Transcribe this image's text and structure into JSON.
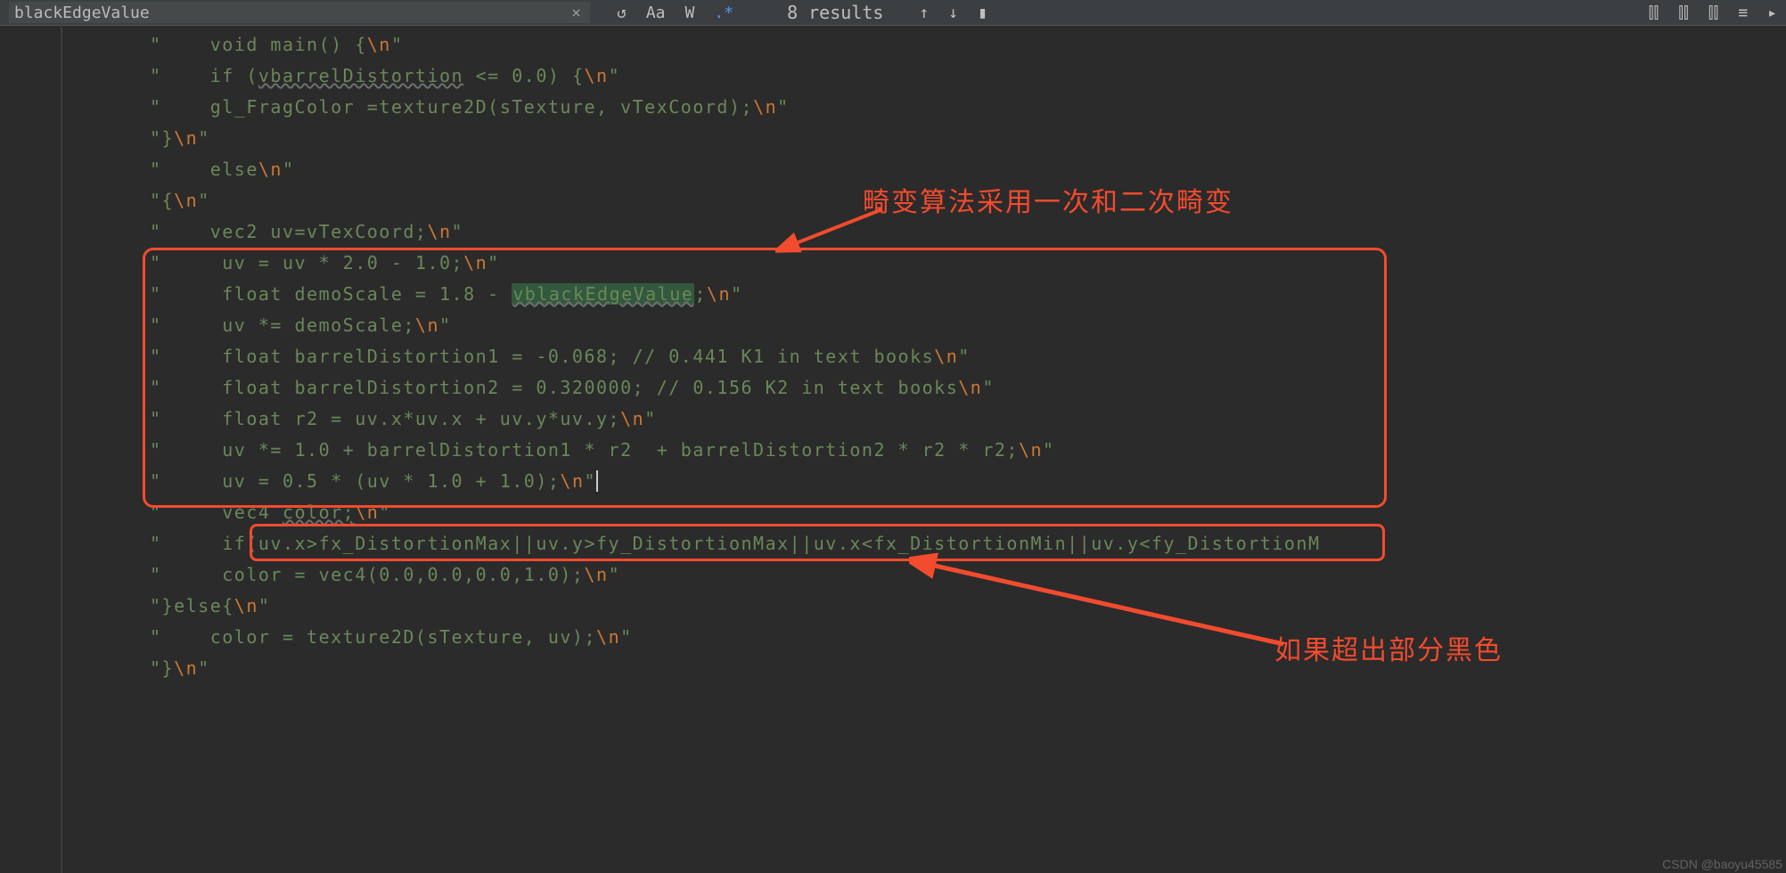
{
  "search": {
    "query": "blackEdgeValue",
    "results": "8 results"
  },
  "toolbar": {
    "close": "×",
    "prev": "↑",
    "next": "↓",
    "aa": "Aa",
    "ww": "W",
    "regex": ".*",
    "arrow_up": "↑",
    "arrow_down": "↓",
    "select_all": "▮",
    "filter1": "⫿⫿",
    "filter2": "⫿⫿",
    "filter3": "⫿⫿",
    "more": "≡",
    "pin": "▸"
  },
  "code": {
    "l01_a": "\"    void main() {",
    "l01_b": "\\n",
    "l01_c": "\"",
    "l02_a": "\"    if (",
    "l02_warn": "vbarrelDistortion",
    "l02_b": " <= 0.0) {",
    "l02_nl": "\\n",
    "l02_c": "\"",
    "l03_a": "\"    gl_FragColor =texture2D(sTexture, vTexCoord);",
    "l03_nl": "\\n",
    "l03_c": "\"",
    "l04_a": "\"}",
    "l04_nl": "\\n",
    "l04_c": "\"",
    "l05_a": "\"    else",
    "l05_nl": "\\n",
    "l05_c": "\"",
    "l06_a": "\"{",
    "l06_nl": "\\n",
    "l06_c": "\"",
    "l07_a": "\"    vec2 uv=vTexCoord;",
    "l07_nl": "\\n",
    "l07_c": "\"",
    "l08_a": "\"     uv = uv * 2.0 - 1.0;",
    "l08_nl": "\\n",
    "l08_c": "\"",
    "l09_a": "\"     float demoScale = 1.8 - ",
    "l09_hl": "vblackEdgeValue",
    "l09_b": ";",
    "l09_nl": "\\n",
    "l09_c": "\"",
    "l10_a": "\"     uv *= demoScale;",
    "l10_nl": "\\n",
    "l10_c": "\"",
    "l11_a": "\"     float barrelDistortion1 = -0.068; // 0.441 K1 in text books",
    "l11_nl": "\\n",
    "l11_c": "\"",
    "l12_a": "\"     float barrelDistortion2 = 0.320000; // 0.156 K2 in text books",
    "l12_nl": "\\n",
    "l12_c": "\"",
    "l13_a": "\"     float r2 = uv.x*uv.x + uv.y*uv.y;",
    "l13_nl": "\\n",
    "l13_c": "\"",
    "l14_a": "\"     uv *= 1.0 + barrelDistortion1 * r2  + barrelDistortion2 * r2 * r2;",
    "l14_nl": "\\n",
    "l14_c": "\"",
    "l15_a": "\"     uv = 0.5 * (uv * 1.0 + 1.0);",
    "l15_nl": "\\n",
    "l15_c": "\"",
    "l16_a": "\"     vec4 ",
    "l16_warn": "color;",
    "l16_nl": "\\n",
    "l16_c": "\"",
    "l17_a": "\"     if(uv.x>fx_DistortionMax||uv.y>fy_DistortionMax||uv.x<fx_DistortionMin||uv.y<fy_DistortionM",
    "l18_a": "\"     color = vec4(0.0,0.0,0.0,1.0);",
    "l18_nl": "\\n",
    "l18_c": "\"",
    "l19_a": "\"}else{",
    "l19_nl": "\\n",
    "l19_c": "\"",
    "l20_a": "\"    color = texture2D(sTexture, uv);",
    "l20_nl": "\\n",
    "l20_c": "\"",
    "l21_a": "\"}",
    "l21_nl": "\\n",
    "l21_c": "\""
  },
  "annotations": {
    "a1": "畸变算法采用一次和二次畸变",
    "a2": "如果超出部分黑色"
  },
  "watermark": "CSDN @baoyu45585"
}
